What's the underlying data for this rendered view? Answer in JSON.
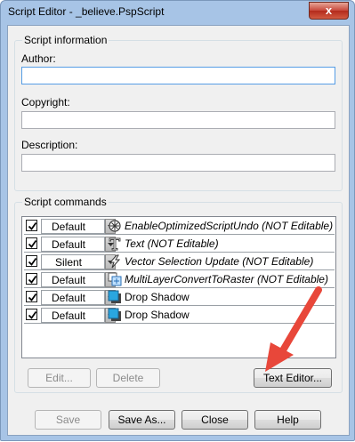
{
  "window": {
    "title": "Script Editor - _believe.PspScript",
    "close_glyph": "x"
  },
  "script_info": {
    "group_title": "Script information",
    "author_label": "Author:",
    "author_value": "",
    "copyright_label": "Copyright:",
    "copyright_value": "",
    "description_label": "Description:",
    "description_value": ""
  },
  "script_commands": {
    "group_title": "Script commands",
    "rows": [
      {
        "checked": true,
        "mode": "Default",
        "icon": "optimize-icon",
        "command": "EnableOptimizedScriptUndo (NOT Editable)",
        "italic": true
      },
      {
        "checked": true,
        "mode": "Default",
        "icon": "text-tool-icon",
        "command": "Text (NOT Editable)",
        "italic": true
      },
      {
        "checked": true,
        "mode": "Silent",
        "icon": "vector-selection-icon",
        "command": "Vector Selection Update (NOT Editable)",
        "italic": true
      },
      {
        "checked": true,
        "mode": "Default",
        "icon": "layer-convert-icon",
        "command": "MultiLayerConvertToRaster (NOT Editable)",
        "italic": true
      },
      {
        "checked": true,
        "mode": "Default",
        "icon": "drop-shadow-icon",
        "command": "Drop Shadow",
        "italic": false
      },
      {
        "checked": true,
        "mode": "Default",
        "icon": "drop-shadow-icon",
        "command": "Drop Shadow",
        "italic": false
      }
    ],
    "edit_label": "Edit...",
    "delete_label": "Delete",
    "text_editor_label": "Text Editor..."
  },
  "footer": {
    "save_label": "Save",
    "save_as_label": "Save As...",
    "close_label": "Close",
    "help_label": "Help"
  },
  "colors": {
    "annotation_arrow": "#e8473a",
    "titlebar": "#a7c4e6"
  }
}
